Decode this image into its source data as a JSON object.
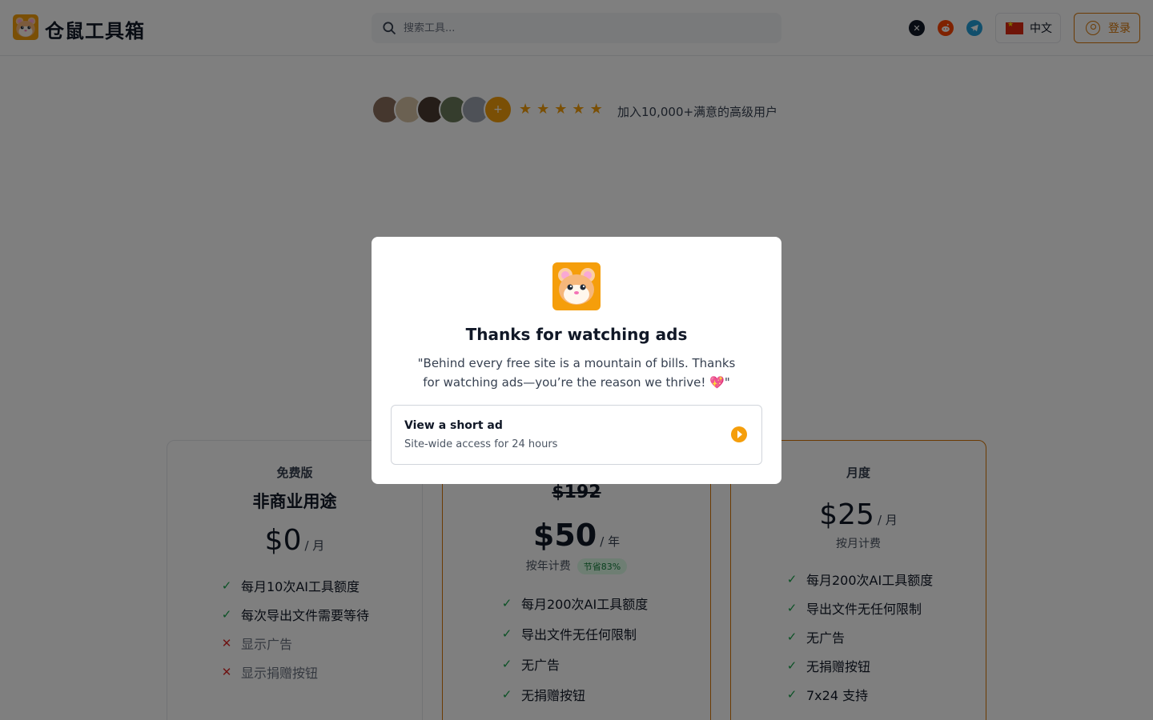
{
  "header": {
    "brand": "仓鼠工具箱",
    "search_placeholder": "搜索工具...",
    "social": [
      "x-icon",
      "reddit-icon",
      "telegram-icon"
    ],
    "language_label": "中文",
    "login_label": "登录"
  },
  "social_proof": {
    "avatar_count": 5,
    "plus_label": "+",
    "rating_stars": 5,
    "text": "加入10,000+满意的高级用户"
  },
  "plans": {
    "free": {
      "title": "免费版",
      "subtitle": "非商业用途",
      "price": "$0",
      "period": "/ 月",
      "features": [
        {
          "label": "每月10次AI工具额度",
          "included": true
        },
        {
          "label": "每次导出文件需要等待",
          "included": true
        },
        {
          "label": "显示广告",
          "included": false
        },
        {
          "label": "显示捐赠按钮",
          "included": false
        }
      ]
    },
    "yearly": {
      "original_price": "$192",
      "price": "$50",
      "period": "/ 年",
      "billing": "按年计费",
      "save_badge": "节省83%",
      "features": [
        {
          "label": "每月200次AI工具额度",
          "included": true
        },
        {
          "label": "导出文件无任何限制",
          "included": true
        },
        {
          "label": "无广告",
          "included": true
        },
        {
          "label": "无捐赠按钮",
          "included": true
        }
      ]
    },
    "monthly": {
      "title": "月度",
      "price": "$25",
      "period": "/ 月",
      "billing": "按月计费",
      "features": [
        {
          "label": "每月200次AI工具额度",
          "included": true
        },
        {
          "label": "导出文件无任何限制",
          "included": true
        },
        {
          "label": "无广告",
          "included": true
        },
        {
          "label": "无捐赠按钮",
          "included": true
        },
        {
          "label": "7x24 支持",
          "included": true
        }
      ]
    }
  },
  "modal": {
    "title": "Thanks for watching ads",
    "description": "\"Behind every free site is a mountain of bills. Thanks for watching ads—you’re the reason we thrive! 💖\"",
    "option_title": "View a short ad",
    "option_subtitle": "Site-wide access for 24 hours"
  },
  "colors": {
    "accent": "#f59e0b",
    "accent_dark": "#d97706",
    "check": "#16a34a",
    "cross": "#dc2626",
    "overlay": "rgba(0,0,0,0.5)"
  }
}
